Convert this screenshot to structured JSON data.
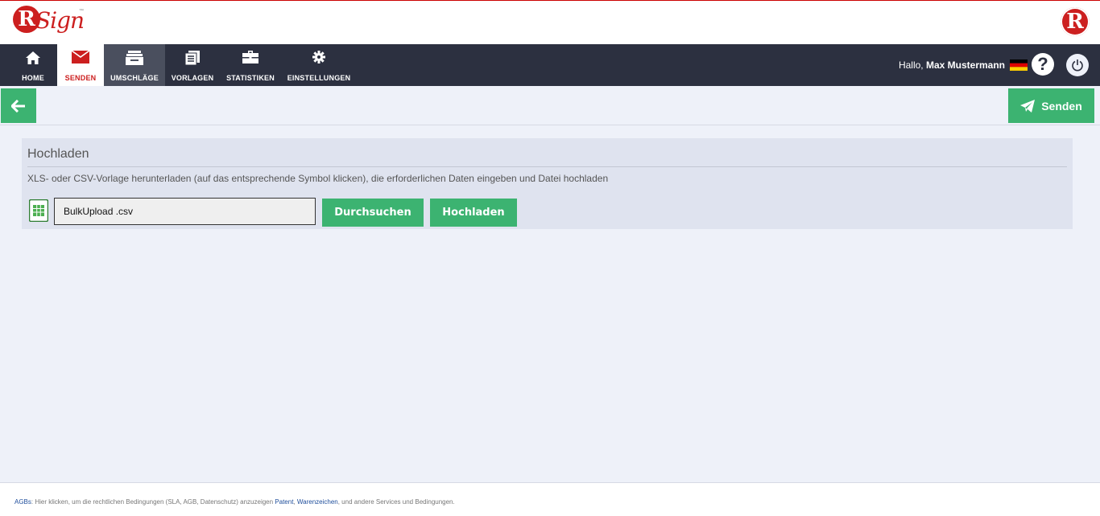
{
  "header": {
    "logo_letter": "R",
    "logo_text": "Sign",
    "logo_tm": "™",
    "brand_letter": "R"
  },
  "nav": {
    "items": [
      {
        "label": "HOME",
        "icon": "home-icon"
      },
      {
        "label": "SENDEN",
        "icon": "envelope-icon"
      },
      {
        "label": "UMSCHLÄGE",
        "icon": "inbox-icon"
      },
      {
        "label": "VORLAGEN",
        "icon": "documents-icon"
      },
      {
        "label": "STATISTIKEN",
        "icon": "briefcase-icon"
      },
      {
        "label": "EINSTELLUNGEN",
        "icon": "gear-icon"
      }
    ],
    "greeting_prefix": "Hallo, ",
    "user_name": "Max Mustermann",
    "help_label": "?"
  },
  "toolbar": {
    "send_label": "Senden"
  },
  "upload": {
    "title": "Hochladen",
    "description": "XLS- oder CSV-Vorlage herunterladen (auf das entsprechende Symbol klicken), die erforderlichen Daten eingeben und Datei hochladen",
    "file_value": "BulkUpload .csv",
    "browse_label": "Durchsuchen",
    "upload_label": "Hochladen"
  },
  "footer": {
    "agb_link": "AGBs",
    "text1": ": Hier klicken, um die rechtlichen Bedingungen (SLA, AGB, Datenschutz) anzuzeigen ",
    "patent_link": "Patent",
    "sep": ", ",
    "trademark_link": "Warenzeichen",
    "text2": ", und andere Services und Bedingungen."
  },
  "colors": {
    "accent_green": "#3cb371",
    "brand_red": "#cc1f1f",
    "nav_bg": "#2c3040"
  }
}
